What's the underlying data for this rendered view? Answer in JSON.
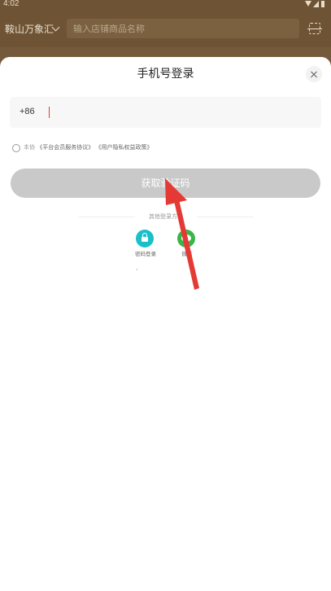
{
  "status_bar": {
    "time": "4:02"
  },
  "background": {
    "city": "鞍山万象汇",
    "search_placeholder": "输入店铺商品名称"
  },
  "login_sheet": {
    "title": "手机号登录",
    "phone_prefix": "+86",
    "phone_value": "",
    "agreement": {
      "prefix": "本协",
      "link1": "《平台会员服务协议》",
      "link2": "《用户隐私权益政策》"
    },
    "get_code_label": "获取验证码",
    "other_methods_label": "其他登录方式",
    "alt_methods": [
      {
        "label": "密码登录",
        "icon": "lock-icon",
        "color": "#1bbfc8"
      },
      {
        "label": "微信",
        "icon": "wechat-icon",
        "color": "#3ab54a"
      }
    ]
  },
  "annotation": {
    "arrow_color": "#e53935"
  }
}
